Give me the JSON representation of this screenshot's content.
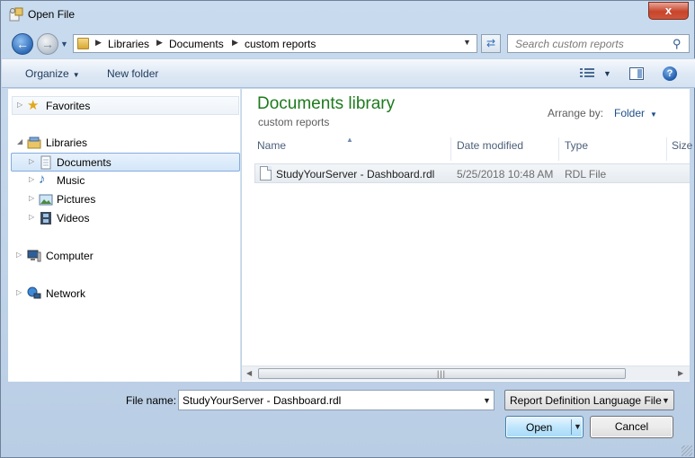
{
  "window": {
    "title": "Open File",
    "close_label": "x"
  },
  "address": {
    "crumbs": [
      "Libraries",
      "Documents",
      "custom reports"
    ],
    "search_placeholder": "Search custom reports"
  },
  "toolbar": {
    "organize_label": "Organize",
    "new_folder_label": "New folder",
    "help_label": "?"
  },
  "nav": {
    "favorites": "Favorites",
    "libraries": "Libraries",
    "documents": "Documents",
    "music": "Music",
    "pictures": "Pictures",
    "videos": "Videos",
    "computer": "Computer",
    "network": "Network"
  },
  "content": {
    "library_title": "Documents library",
    "library_subtitle": "custom reports",
    "arrange_by_label": "Arrange by:",
    "arrange_by_value": "Folder",
    "columns": [
      "Name",
      "Date modified",
      "Type",
      "Size"
    ],
    "files": [
      {
        "name": "StudyYourServer - Dashboard.rdl",
        "date_modified": "5/25/2018 10:48 AM",
        "type": "RDL File"
      }
    ]
  },
  "bottom": {
    "file_name_label": "File name:",
    "file_name_value": "StudyYourServer - Dashboard.rdl",
    "file_type_value": "Report Definition Language File",
    "open_label": "Open",
    "cancel_label": "Cancel"
  },
  "colors": {
    "library_title": "#1e7a1e",
    "link_blue": "#1e4f8a",
    "selection_border": "#84acdd"
  }
}
